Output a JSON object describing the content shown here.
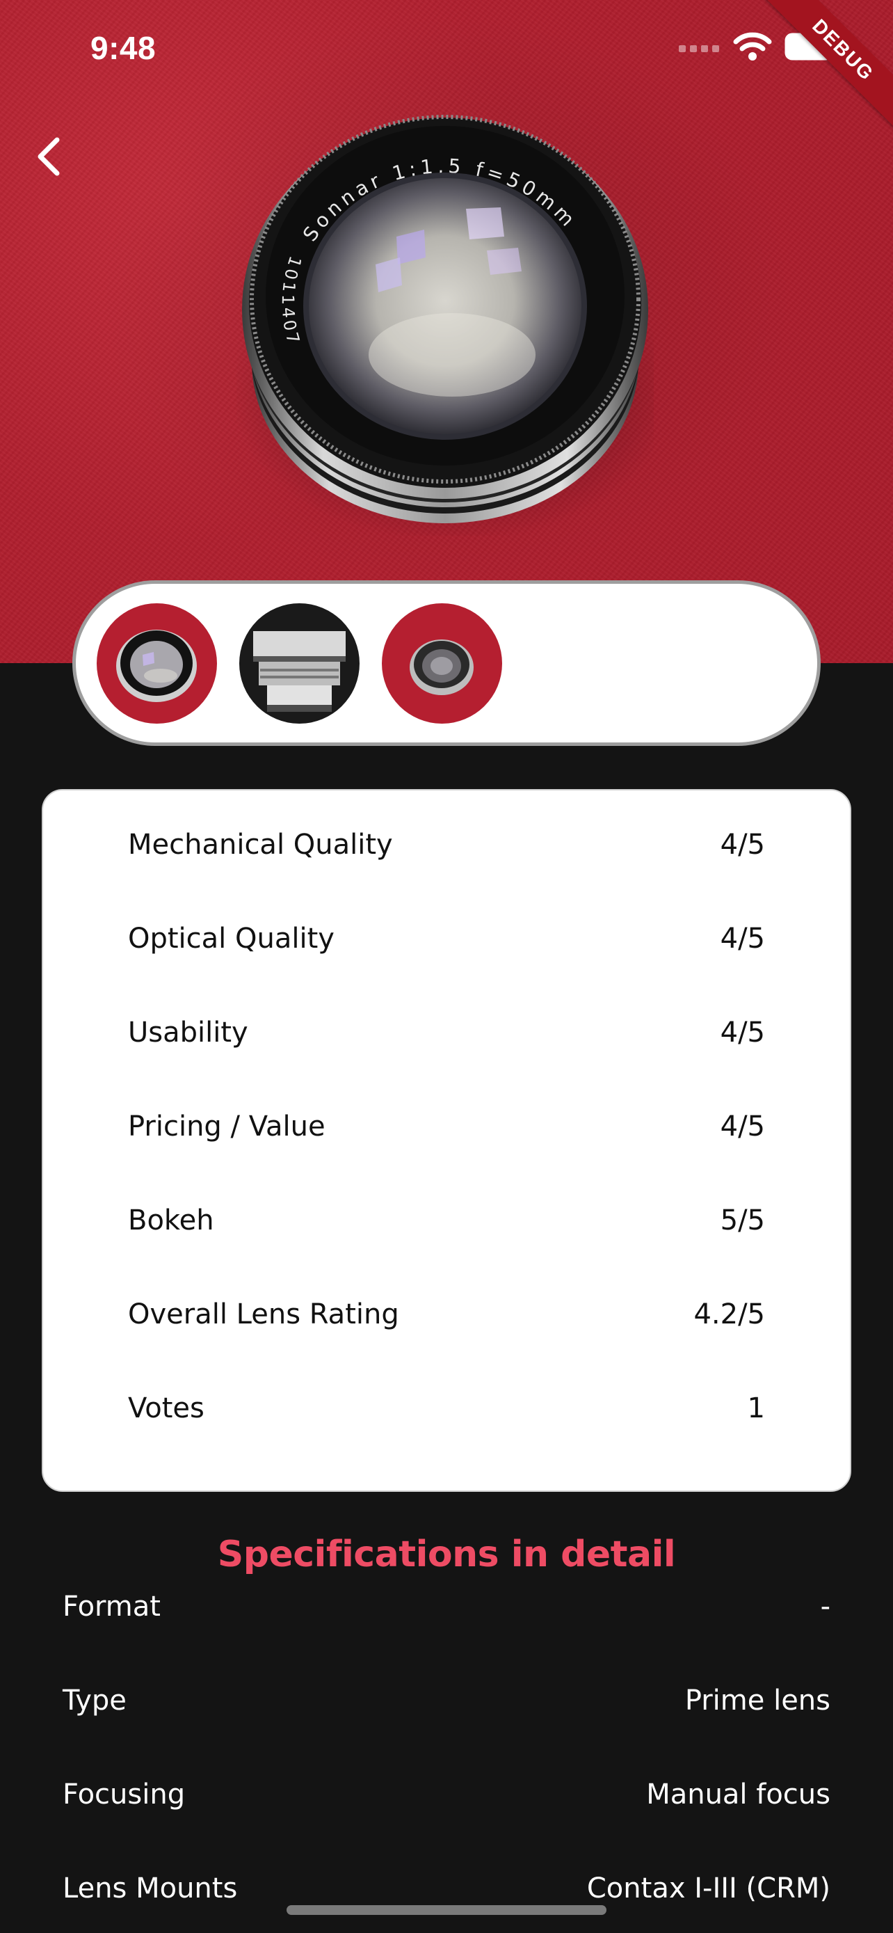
{
  "status_bar": {
    "time": "9:48",
    "debug_label": "DEBUG"
  },
  "hero": {
    "lens_engraving": "Sonnar 1:1,5  f=50mm",
    "lens_serial": "1011407"
  },
  "thumbnails": [
    {
      "name": "thumbnail-front"
    },
    {
      "name": "thumbnail-side"
    },
    {
      "name": "thumbnail-rear"
    }
  ],
  "ratings": [
    {
      "label": "Mechanical Quality",
      "value": "4/5"
    },
    {
      "label": "Optical Quality",
      "value": "4/5"
    },
    {
      "label": "Usability",
      "value": "4/5"
    },
    {
      "label": "Pricing / Value",
      "value": "4/5"
    },
    {
      "label": "Bokeh",
      "value": "5/5"
    },
    {
      "label": "Overall Lens Rating",
      "value": "4.2/5"
    },
    {
      "label": "Votes",
      "value": "1"
    }
  ],
  "specs": {
    "title": "Specifications in detail",
    "rows": [
      {
        "label": "Format",
        "value": "-"
      },
      {
        "label": "Type",
        "value": "Prime lens"
      },
      {
        "label": "Focusing",
        "value": "Manual focus"
      },
      {
        "label": "Lens Mounts",
        "value": "Contax I-III (CRM)"
      }
    ]
  },
  "colors": {
    "accent": "#ee4c64",
    "background": "#141414",
    "hero_red": "#b01f2e"
  },
  "icons": {
    "back": "chevron-left-icon",
    "signal": "signal-icon",
    "wifi": "wifi-icon",
    "battery": "battery-icon"
  }
}
